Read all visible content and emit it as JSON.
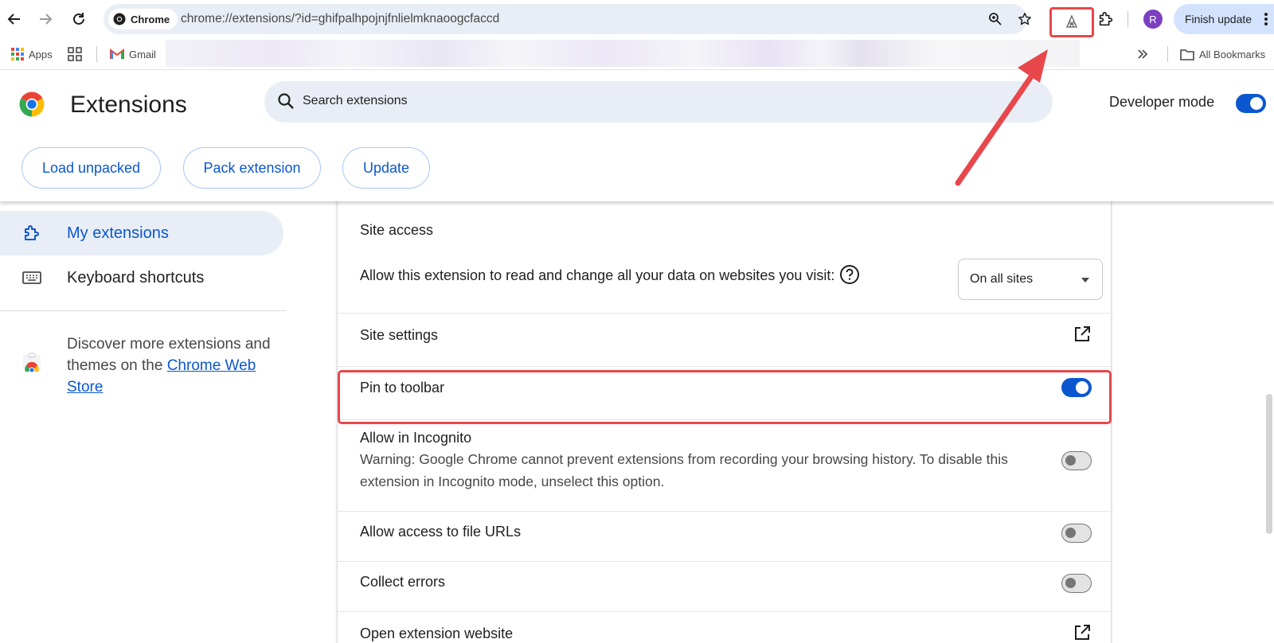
{
  "browser": {
    "chip_label": "Chrome",
    "url": "chrome://extensions/?id=ghifpalhpojnjfnlielmknaoogcfaccd",
    "avatar_initial": "R",
    "finish_update_label": "Finish update"
  },
  "bookmarks": {
    "apps_label": "Apps",
    "gmail_label": "Gmail",
    "all_bookmarks_label": "All Bookmarks"
  },
  "header": {
    "title": "Extensions",
    "search_placeholder": "Search extensions",
    "developer_mode_label": "Developer mode",
    "developer_mode_on": true,
    "buttons": {
      "load_unpacked": "Load unpacked",
      "pack_extension": "Pack extension",
      "update": "Update"
    }
  },
  "sidebar": {
    "items": [
      {
        "label": "My extensions",
        "icon": "extension-puzzle-icon",
        "active": true
      },
      {
        "label": "Keyboard shortcuts",
        "icon": "keyboard-icon",
        "active": false
      }
    ],
    "discover_text": "Discover more extensions and themes on the",
    "store_link": "Chrome Web Store"
  },
  "details": {
    "site_access_heading": "Site access",
    "site_access_text": "Allow this extension to read and change all your data on websites you visit:",
    "site_access_value": "On all sites",
    "site_settings_label": "Site settings",
    "pin_label": "Pin to toolbar",
    "pin_on": true,
    "incognito_label": "Allow in Incognito",
    "incognito_warning": "Warning: Google Chrome cannot prevent extensions from recording your browsing history. To disable this extension in Incognito mode, unselect this option.",
    "incognito_on": false,
    "file_urls_label": "Allow access to file URLs",
    "file_urls_on": false,
    "collect_errors_label": "Collect errors",
    "collect_errors_on": false,
    "partial_row_label": "Open extension website"
  },
  "colors": {
    "accent": "#0b57d0",
    "highlight": "#e8474c",
    "omnibox_bg": "#e9eef6",
    "update_bg": "#d3e3fd"
  }
}
